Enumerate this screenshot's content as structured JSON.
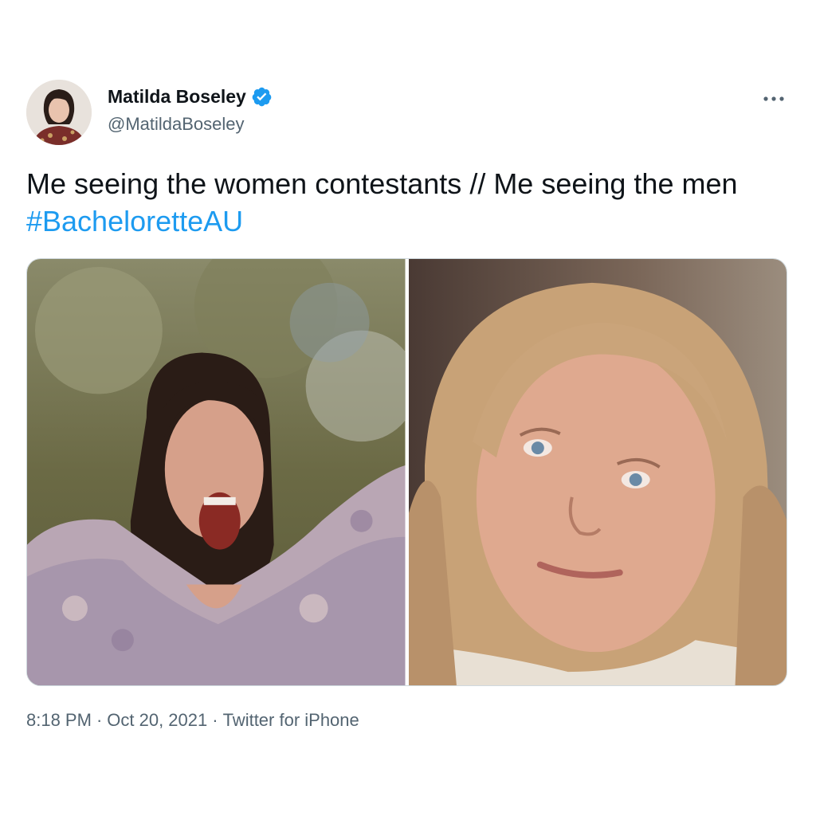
{
  "author": {
    "display_name": "Matilda Boseley",
    "handle": "@MatildaBoseley",
    "verified_icon": "verified-badge-icon",
    "verified_color": "#1d9bf0"
  },
  "more_icon": "more-horizontal-icon",
  "tweet": {
    "text": "Me seeing the women contestants // Me seeing the men ",
    "hashtag": "#BacheloretteAU",
    "hashtag_color": "#1d9bf0"
  },
  "media": [
    {
      "name": "photo-left",
      "description": "woman screaming with arms outstretched"
    },
    {
      "name": "photo-right",
      "description": "older woman with neutral expression"
    }
  ],
  "meta": {
    "time": "8:18 PM",
    "date": "Oct 20, 2021",
    "source": "Twitter for iPhone",
    "separator": "·"
  },
  "colors": {
    "text": "#0f1419",
    "secondary": "#536471",
    "accent": "#1d9bf0"
  }
}
